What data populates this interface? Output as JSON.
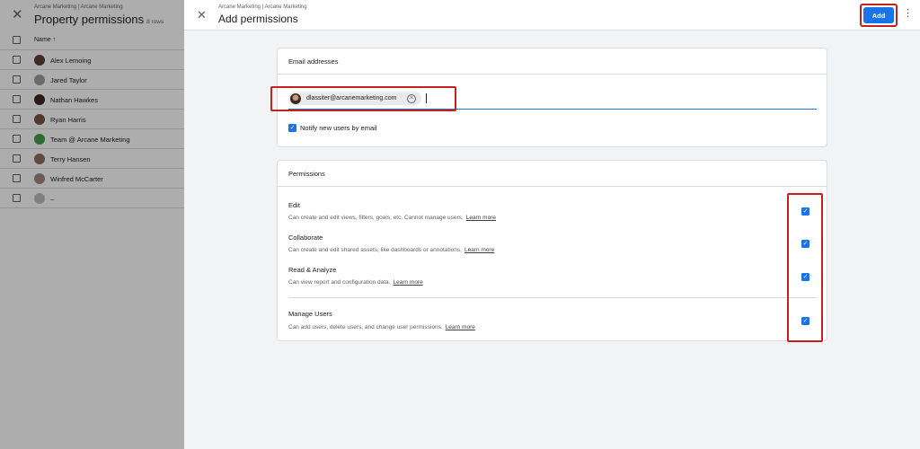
{
  "background_panel": {
    "breadcrumb": "Arcane Marketing | Arcane Marketing",
    "title": "Property permissions",
    "row_count": "8 rows",
    "column_header": "Name",
    "users": [
      {
        "name": "Alex Lemoing",
        "avatar_color": "#5d4037"
      },
      {
        "name": "Jared Taylor",
        "avatar_color": "#9e9e9e"
      },
      {
        "name": "Nathan Hawkes",
        "avatar_color": "#3e2723"
      },
      {
        "name": "Ryan Harris",
        "avatar_color": "#795548"
      },
      {
        "name": "Team @ Arcane Marketing",
        "avatar_color": "#43a047"
      },
      {
        "name": "Terry Hansen",
        "avatar_color": "#8d6e63"
      },
      {
        "name": "Winfred McCarter",
        "avatar_color": "#a1887f"
      },
      {
        "name": "–",
        "avatar_color": "#bdbdbd"
      }
    ]
  },
  "dialog": {
    "breadcrumb": "Arcane Marketing | Arcane Marketing",
    "title": "Add permissions",
    "add_label": "Add",
    "close_icon": "close-icon",
    "more_icon": "more-vert-icon"
  },
  "email_section": {
    "title": "Email addresses",
    "chip_email": "dlassiter@arcanemarketing.com",
    "notify_label": "Notify new users by email",
    "notify_checked": true
  },
  "permissions": {
    "title": "Permissions",
    "learn_more": "Learn more",
    "items": [
      {
        "title": "Edit",
        "description": "Can create and edit views, filters, goals, etc. Cannot manage users.",
        "checked": true
      },
      {
        "title": "Collaborate",
        "description": "Can create and edit shared assets, like dashboards or annotations.",
        "checked": true
      },
      {
        "title": "Read & Analyze",
        "description": "Can view report and configuration data.",
        "checked": true
      },
      {
        "title": "Manage Users",
        "description": "Can add users, delete users, and change user permissions.",
        "checked": true
      }
    ]
  },
  "colors": {
    "accent": "#1a73e8",
    "highlight": "#c5221f"
  }
}
